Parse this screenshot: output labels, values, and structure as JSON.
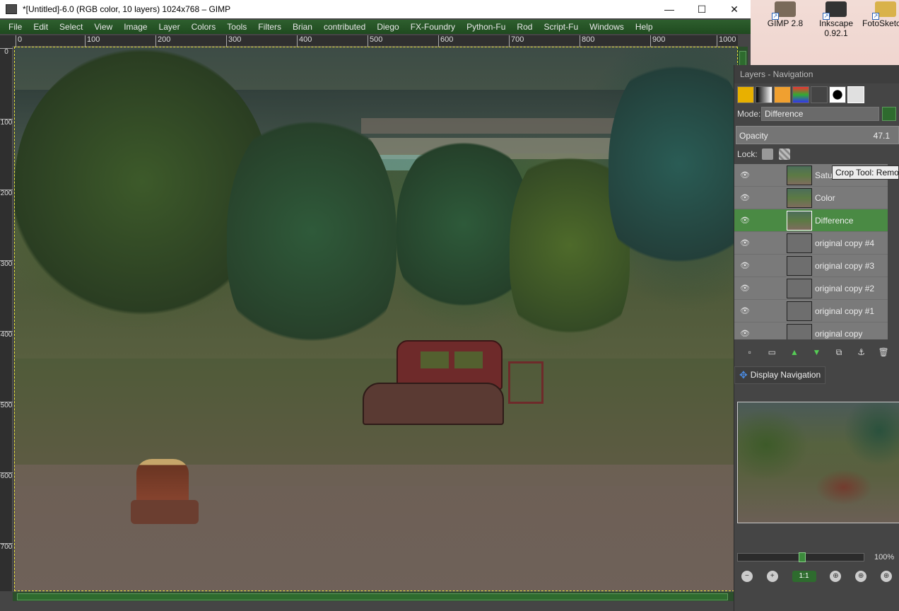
{
  "window": {
    "title": "*[Untitled]-6.0 (RGB color, 10 layers) 1024x768 – GIMP",
    "controls": [
      "—",
      "☐",
      "✕"
    ]
  },
  "menu": [
    "File",
    "Edit",
    "Select",
    "View",
    "Image",
    "Layer",
    "Colors",
    "Tools",
    "Filters",
    "Brian",
    "contributed",
    "Diego",
    "FX-Foundry",
    "Python-Fu",
    "Rod",
    "Script-Fu",
    "Windows",
    "Help"
  ],
  "ruler_h": [
    "0",
    "100",
    "200",
    "300",
    "400",
    "500",
    "600",
    "700",
    "800",
    "900",
    "1000"
  ],
  "ruler_v": [
    "0",
    "100",
    "200",
    "300",
    "400",
    "500",
    "600",
    "700"
  ],
  "desktop_icons": [
    {
      "label": "GIMP 2.8"
    },
    {
      "label": "Inkscape 0.92.1"
    },
    {
      "label": "FotoSketcher"
    }
  ],
  "dock": {
    "title": "Layers - Navigation",
    "mode_label": "Mode:",
    "mode_value": "Difference",
    "opacity_label": "Opacity",
    "opacity_value": "47.1",
    "lock_label": "Lock:",
    "layers": [
      {
        "name": "Saturation",
        "thumb": "image"
      },
      {
        "name": "Color",
        "thumb": "image"
      },
      {
        "name": "Difference",
        "thumb": "image",
        "selected": true
      },
      {
        "name": "original copy #4",
        "thumb": "blank"
      },
      {
        "name": "original copy #3",
        "thumb": "blank"
      },
      {
        "name": "original copy #2",
        "thumb": "blank"
      },
      {
        "name": "original copy #1",
        "thumb": "blank"
      },
      {
        "name": "original copy",
        "thumb": "blank"
      }
    ],
    "tooltip": "Crop Tool: Remove",
    "nav_tab": "Display Navigation",
    "zoom": "100%"
  }
}
